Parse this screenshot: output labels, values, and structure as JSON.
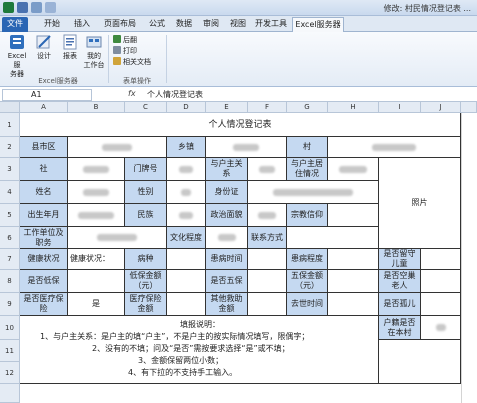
{
  "window": {
    "title": "修改: 村民情况登记表 ..."
  },
  "ribbon_tabs": [
    "文件",
    "开始",
    "插入",
    "页面布局",
    "公式",
    "数据",
    "审阅",
    "视图",
    "开发工具",
    "Excel服务器"
  ],
  "ribbon": {
    "buttons": [
      {
        "label": "Excel服\n务器",
        "icon": "server-icon"
      },
      {
        "label": "设计",
        "icon": "design-icon"
      },
      {
        "label": "报表",
        "icon": "report-icon"
      },
      {
        "label": "我的\n工作台",
        "icon": "workbench-icon"
      }
    ],
    "small_buttons": [
      {
        "label": "后翻",
        "icon": "next-icon"
      },
      {
        "label": "打印",
        "icon": "print-icon"
      },
      {
        "label": "相关文档",
        "icon": "doc-icon"
      }
    ],
    "groups": [
      "Excel服务器",
      "表单操作"
    ]
  },
  "formula_bar": {
    "name_box": "A1",
    "fx": "fx",
    "formula": "个人情况登记表"
  },
  "columns": [
    "A",
    "B",
    "C",
    "D",
    "E",
    "F",
    "G",
    "H",
    "I",
    "J"
  ],
  "rows": [
    "1",
    "2",
    "3",
    "4",
    "5",
    "6",
    "7",
    "8",
    "9",
    "10",
    "11",
    "12"
  ],
  "form": {
    "title": "个人情况登记表",
    "labels": {
      "county": "县市区",
      "township": "乡镇",
      "village": "村",
      "society": "社",
      "house_no": "门牌号",
      "relation": "与户主关系",
      "residence": "与户主居住情况",
      "name": "姓名",
      "gender": "性别",
      "id_card": "身份证",
      "photo": "照片",
      "birth": "出生年月",
      "ethnic": "民族",
      "political": "政治面貌",
      "religion": "宗教信仰",
      "work_unit": "工作单位及职务",
      "education": "文化程度",
      "contact": "联系方式",
      "health": "健康状况",
      "disease": "病种",
      "sick_time": "患病时间",
      "sick_degree": "患病程度",
      "left_child": "是否留守儿童",
      "low_income": "是否低保",
      "low_amount": "低保金额（元）",
      "five_guarantee": "是否五保",
      "five_amount": "五保金额（元）",
      "empty_nest": "是否空巢老人",
      "medical": "是否医疗保险",
      "medical_amount": "医疗保险金额",
      "other_aid": "其他救助金额",
      "death_time": "去世时间",
      "orphan": "是否孤儿",
      "resident": "户籍是否在本村"
    },
    "values": {
      "health": "健康状况：",
      "medical": "是"
    },
    "notes": [
      "填报说明：",
      "1、与户主关系：是户主的填“户主”，不是户主的按实际情况填写，限偶字；",
      "2、没有的不填；问及“是否”需按要求选择“是”或不填；",
      "3、金额保留两位小数；",
      "4、有下拉的不支持手工输入。"
    ]
  }
}
